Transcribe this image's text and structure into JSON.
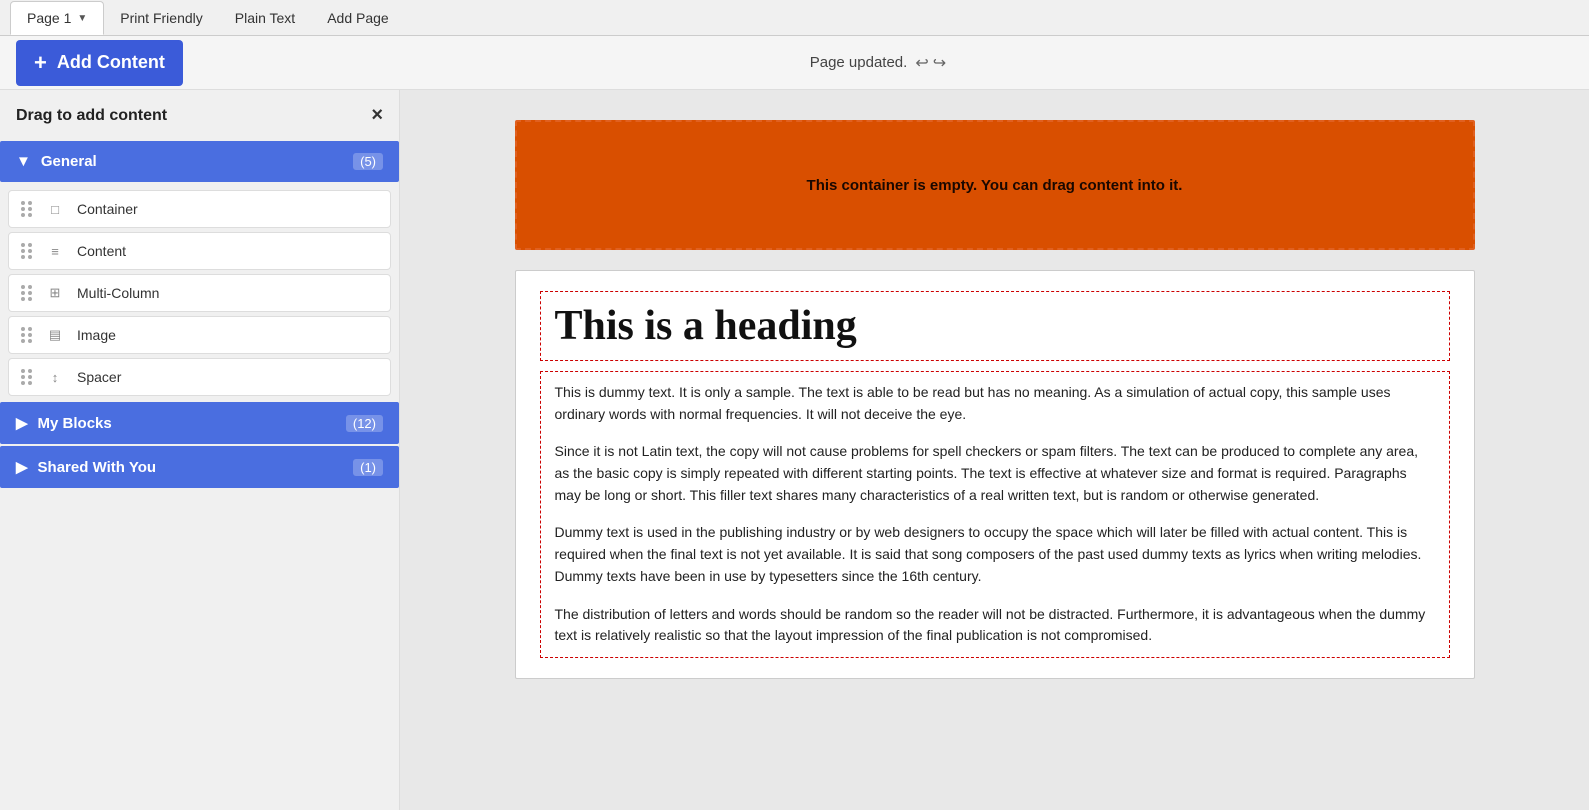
{
  "tabs": [
    {
      "id": "page1",
      "label": "Page 1",
      "active": true
    },
    {
      "id": "print-friendly",
      "label": "Print Friendly",
      "active": false
    },
    {
      "id": "plain-text",
      "label": "Plain Text",
      "active": false
    },
    {
      "id": "add-page",
      "label": "Add Page",
      "active": false
    }
  ],
  "toolbar": {
    "add_content_label": "Add Content",
    "page_updated_label": "Page updated.",
    "undo_icon": "↩",
    "redo_icon": "↪"
  },
  "sidebar": {
    "header": "Drag to add content",
    "close_label": "×",
    "sections": [
      {
        "id": "general",
        "label": "General",
        "count": "(5)",
        "expanded": true,
        "arrow": "▼",
        "items": [
          {
            "id": "container",
            "label": "Container",
            "icon": "□"
          },
          {
            "id": "content",
            "label": "Content",
            "icon": "≡"
          },
          {
            "id": "multi-column",
            "label": "Multi-Column",
            "icon": "⊞"
          },
          {
            "id": "image",
            "label": "Image",
            "icon": "▤"
          },
          {
            "id": "spacer",
            "label": "Spacer",
            "icon": "↕"
          }
        ]
      },
      {
        "id": "my-blocks",
        "label": "My Blocks",
        "count": "(12)",
        "expanded": false,
        "arrow": "▶"
      },
      {
        "id": "shared-with-you",
        "label": "Shared With You",
        "count": "(1)",
        "expanded": false,
        "arrow": "▶"
      }
    ]
  },
  "content": {
    "empty_container_text": "This container is empty. You can drag content into it.",
    "heading": "This is a heading",
    "paragraphs": [
      "This is dummy text. It is only a sample. The text is able to be read but has no meaning. As a simulation of actual copy, this sample uses ordinary words with normal frequencies. It will not deceive the eye.",
      "Since it is not Latin text, the copy will not cause problems for spell checkers or spam filters. The text can be produced to complete any area, as the basic copy is simply repeated with different starting points. The text is effective at whatever size and format is required. Paragraphs may be long or short. This filler text shares many characteristics of a real written text, but is random or otherwise generated.",
      "Dummy text is used in the publishing industry or by web designers to occupy the space which will later be filled with actual content. This is required when the final text is not yet available. It is said that song composers of the past used dummy texts as lyrics when writing melodies. Dummy texts have been in use by typesetters since the 16th century.",
      "The distribution of letters and words should be random so the reader will not be distracted. Furthermore, it is advantageous when the dummy text is relatively realistic so that the layout impression of the final publication is not compromised."
    ]
  }
}
